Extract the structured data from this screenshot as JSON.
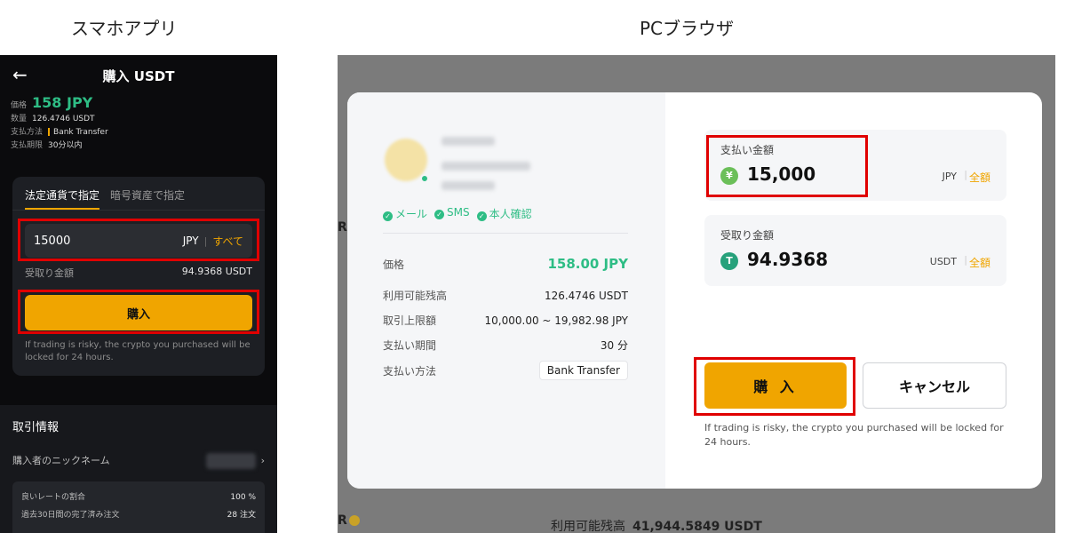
{
  "captions": {
    "mobile": "スマホアプリ",
    "pc": "PCブラウザ"
  },
  "mobile": {
    "back_icon": "←",
    "title": "購入 USDT",
    "price_label": "価格",
    "price_value": "158 JPY",
    "qty_label": "数量",
    "qty_value": "126.4746 USDT",
    "method_label": "支払方法",
    "method_value": "Bank Transfer",
    "deadline_label": "支払期限",
    "deadline_value": "30分以内",
    "tabs": [
      "法定通貨で指定",
      "暗号資産で指定"
    ],
    "input_value": "15000",
    "input_currency": "JPY",
    "input_sep": "|",
    "input_all": "すべて",
    "receive_label": "受取り金額",
    "receive_value": "94.9368 USDT",
    "buy_label": "購入",
    "note": "If trading is risky, the crypto you purchased will be locked for 24 hours.",
    "trade_title": "取引情報",
    "nick_label": "購入者のニックネーム",
    "chevron_icon": "›",
    "stats": [
      {
        "label": "良いレートの割合",
        "value": "100 %"
      },
      {
        "label": "過去30日間の完了済み注文",
        "value": "28 注文"
      }
    ]
  },
  "pc": {
    "edge_letter": "R",
    "verify": [
      "メール",
      "SMS",
      "本人確認"
    ],
    "rows": [
      {
        "label": "価格",
        "value": "158.00 JPY"
      },
      {
        "label": "利用可能残高",
        "value": "126.4746 USDT"
      },
      {
        "label": "取引上限額",
        "value": "10,000.00 ~ 19,982.98 JPY"
      },
      {
        "label": "支払い期間",
        "value": "30 分"
      },
      {
        "label": "支払い方法",
        "value": "Bank Transfer"
      }
    ],
    "pay": {
      "label": "支払い金額",
      "coin": "¥",
      "value": "15,000",
      "currency": "JPY",
      "sep": "|",
      "all": "全額"
    },
    "recv": {
      "label": "受取り金額",
      "coin": "T",
      "value": "94.9368",
      "currency": "USDT",
      "sep": "|",
      "all": "全額"
    },
    "buy_label": "購 入",
    "cancel_label": "キャンセル",
    "note": "If trading is risky, the crypto you purchased will be locked for 24 hours.",
    "bottom_label": "利用可能残高",
    "bottom_value": "41,944.5849 USDT"
  },
  "colors": {
    "accent": "#f0a500",
    "green": "#2ebd85",
    "highlight": "#e00000"
  }
}
